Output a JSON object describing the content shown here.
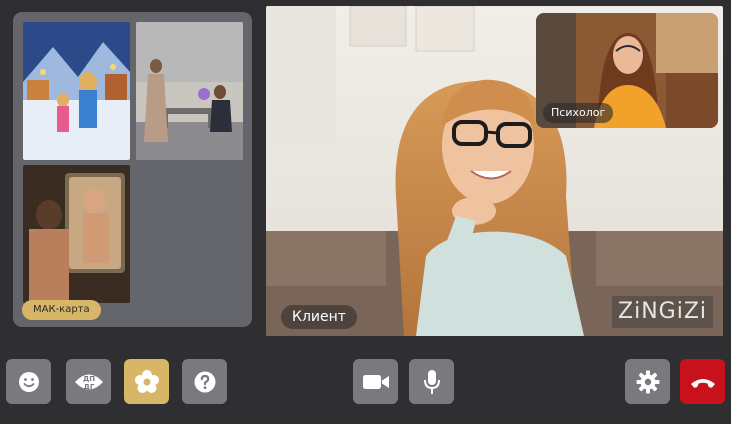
{
  "cards_panel": {
    "badge_label": "МАК-карта",
    "cards": [
      {
        "subject": "winter skating couple"
      },
      {
        "subject": "proposal with flowers"
      },
      {
        "subject": "man at mirror"
      }
    ]
  },
  "main_video": {
    "participant_label": "Клиент",
    "logo_text": "ZiNGiZi"
  },
  "pip_video": {
    "participant_label": "Психолог"
  },
  "toolbar": {
    "left": [
      {
        "icon": "smile-icon"
      },
      {
        "icon": "dp-dg-icon",
        "text_top": "ДП",
        "text_bottom": "ДГ"
      },
      {
        "icon": "flower-icon",
        "active": true
      },
      {
        "icon": "help-icon"
      }
    ],
    "center": [
      {
        "icon": "camera-icon"
      },
      {
        "icon": "microphone-icon"
      }
    ],
    "right": [
      {
        "icon": "gear-icon"
      },
      {
        "icon": "hangup-icon"
      }
    ]
  },
  "colors": {
    "background": "#2f2f31",
    "panel": "#65666b",
    "button": "#7a7a7e",
    "accent": "#d8b667",
    "hangup": "#c8111b"
  }
}
